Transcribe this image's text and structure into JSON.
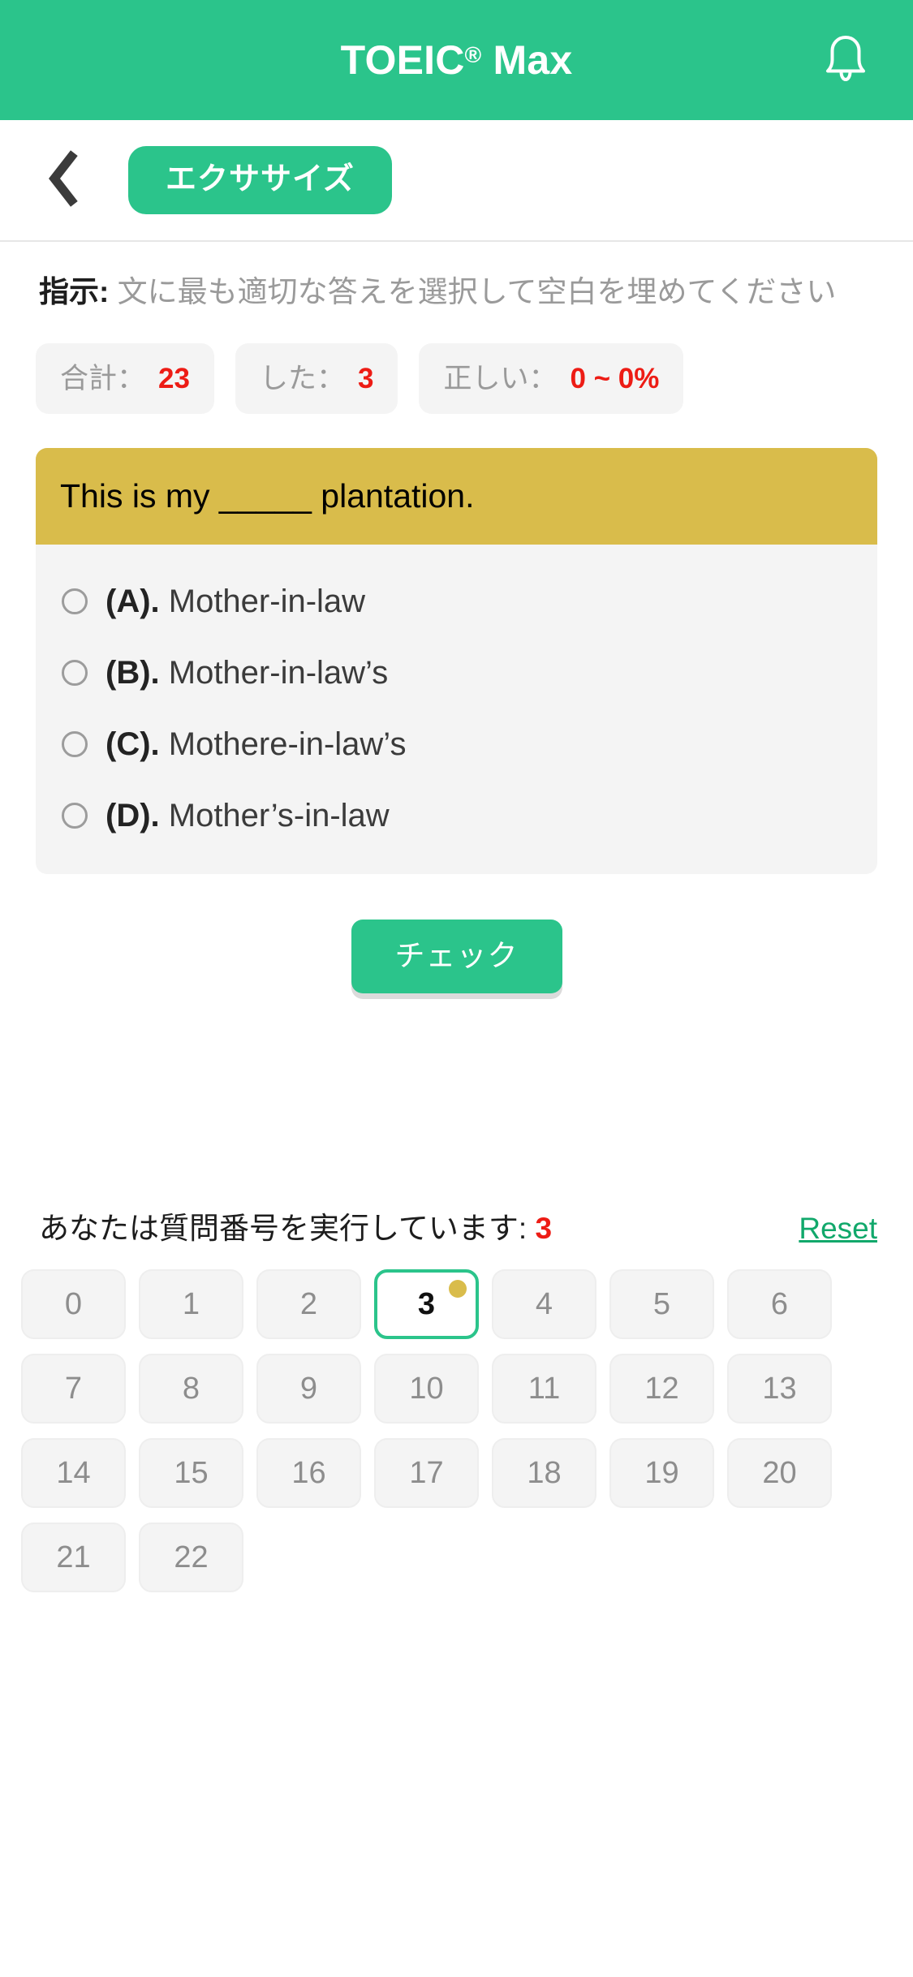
{
  "app": {
    "title": "TOEIC® Max",
    "title_main": "TOEIC",
    "title_reg": "®",
    "title_suffix": " Max",
    "accent_green": "#2BC48B",
    "banner_yellow": "#D9BC4B",
    "danger_red": "#ed1c15",
    "bell_icon": "bell-icon"
  },
  "nav": {
    "back_icon": "chevron-left-icon",
    "pill_label": "エクササイズ"
  },
  "instruction": {
    "lead": "指示:",
    "body": " 文に最も適切な答えを選択して空白を埋めてください"
  },
  "stats": [
    {
      "label": "合計：",
      "value": "23",
      "name": "stat-total"
    },
    {
      "label": "した：",
      "value": "3",
      "name": "stat-done"
    },
    {
      "label": "正しい：",
      "value": "0 ~ 0%",
      "name": "stat-correct"
    }
  ],
  "question": {
    "text": "This is my _____ plantation.",
    "options": [
      {
        "letter": "(A).",
        "text": " Mother-in-law",
        "selected": false
      },
      {
        "letter": "(B).",
        "text": " Mother-in-law’s",
        "selected": false
      },
      {
        "letter": "(C).",
        "text": " Mothere-in-law’s",
        "selected": false
      },
      {
        "letter": "(D).",
        "text": " Mother’s-in-law",
        "selected": false
      }
    ]
  },
  "check_button": {
    "label": "チェック"
  },
  "progress": {
    "label": "あなたは質問番号を実行しています: ",
    "current": "3",
    "reset_label": "Reset"
  },
  "number_grid": {
    "columns": 7,
    "active": "3",
    "badge_on_active": true,
    "cells": [
      "0",
      "1",
      "2",
      "3",
      "4",
      "5",
      "6",
      "7",
      "8",
      "9",
      "10",
      "11",
      "12",
      "13",
      "14",
      "15",
      "16",
      "17",
      "18",
      "19",
      "20",
      "21",
      "22"
    ]
  }
}
